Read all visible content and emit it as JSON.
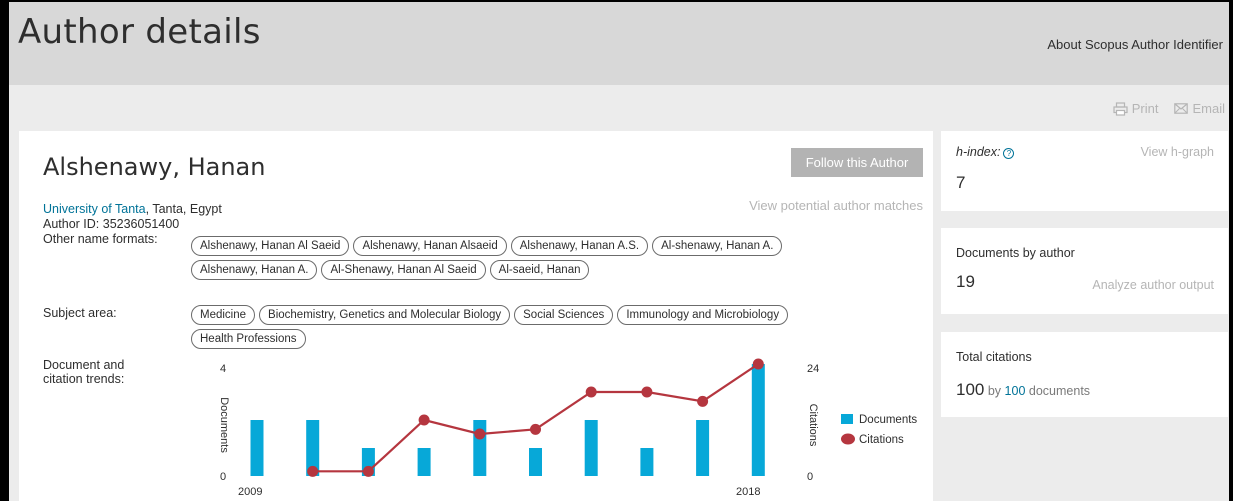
{
  "header": {
    "title": "Author details",
    "about_link": "About Scopus Author Identifier"
  },
  "toolbar": {
    "print_label": "Print",
    "email_label": "Email"
  },
  "author": {
    "name": "Alshenawy, Hanan",
    "follow_label": "Follow this Author",
    "potential_matches": "View potential author matches",
    "affiliation_link": "University of Tanta",
    "affiliation_rest": ", Tanta, Egypt",
    "author_id": "Author ID: 35236051400",
    "other_names_label": "Other name formats:",
    "other_names": [
      "Alshenawy, Hanan Al Saeid",
      "Alshenawy, Hanan Alsaeid",
      "Alshenawy, Hanan A.S.",
      "Al-shenawy, Hanan A.",
      "Alshenawy, Hanan A.",
      "Al-Shenawy, Hanan Al Saeid",
      "Al-saeid, Hanan"
    ],
    "subject_label": "Subject area:",
    "subjects": [
      "Medicine",
      "Biochemistry, Genetics and Molecular Biology",
      "Social Sciences",
      "Immunology and Microbiology",
      "Health Professions"
    ],
    "trends_label_line1": "Document and",
    "trends_label_line2": "citation trends:"
  },
  "metrics": {
    "hindex_label": "h-index:",
    "hindex_help": "?",
    "hgraph_link": "View h-graph",
    "hindex_value": "7",
    "docs_label": "Documents by author",
    "docs_value": "19",
    "analyze_link": "Analyze author output",
    "citations_label": "Total citations",
    "citations_value": "100",
    "citations_by": "by",
    "citations_docs_count": "100",
    "citations_docs_text": "documents"
  },
  "colors": {
    "link": "#007398",
    "bar": "#07a8d8",
    "citation_line": "#b5363f"
  },
  "chart_data": {
    "type": "bar",
    "x": [
      2009,
      2010,
      2011,
      2012,
      2013,
      2014,
      2015,
      2016,
      2017,
      2018
    ],
    "x_tick_labels": [
      "2009",
      "2018"
    ],
    "series": [
      {
        "name": "Documents",
        "type": "bar",
        "axis": "left",
        "values": [
          2,
          2,
          1,
          1,
          2,
          1,
          2,
          1,
          2,
          4
        ]
      },
      {
        "name": "Citations",
        "type": "line",
        "axis": "right",
        "x": [
          2010,
          2011,
          2012,
          2013,
          2014,
          2015,
          2016,
          2017,
          2018
        ],
        "values": [
          1,
          1,
          12,
          9,
          10,
          18,
          18,
          16,
          24
        ]
      }
    ],
    "ylabel": "Documents",
    "ylabel_right": "Citations",
    "ylim": [
      0,
      4
    ],
    "ylim_right": [
      0,
      24
    ],
    "y_ticks": [
      "0",
      "4"
    ],
    "y_ticks_right": [
      "0",
      "24"
    ],
    "legend_position": "right",
    "grid": false
  }
}
